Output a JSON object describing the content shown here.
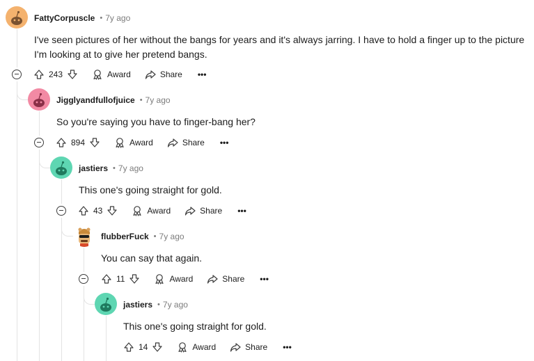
{
  "comments": [
    {
      "username": "FattyCorpuscle",
      "time": "7y ago",
      "body": "I've seen pictures of her without the bangs for years and it's always jarring. I have to hold a finger up to the picture I'm looking at to give her pretend bangs.",
      "votes": "243",
      "avatar_color": "#f4b26e"
    },
    {
      "username": "Jigglyandfullofjuice",
      "time": "7y ago",
      "body": "So you're saying you have to finger-bang her?",
      "votes": "894",
      "avatar_color": "#f28aa4"
    },
    {
      "username": "jastiers",
      "time": "7y ago",
      "body": "This one's going straight for gold.",
      "votes": "43",
      "avatar_color": "#5ed6b2"
    },
    {
      "username": "flubberFuck",
      "time": "7y ago",
      "body": "You can say that again.",
      "votes": "11",
      "avatar_color": "#d9a05b"
    },
    {
      "username": "jastiers",
      "time": "7y ago",
      "body": "This one's going straight for gold.",
      "votes": "14",
      "avatar_color": "#5ed6b2"
    }
  ],
  "labels": {
    "award": "Award",
    "share": "Share",
    "more": "•••"
  }
}
